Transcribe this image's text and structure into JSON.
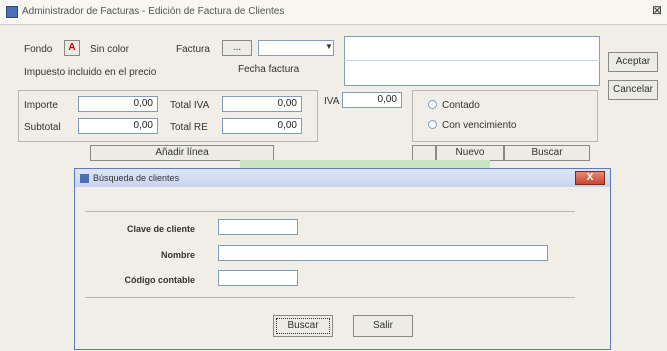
{
  "window": {
    "title": "Administrador de Facturas - Edición de Factura de Clientes",
    "close_glyph": "⊠"
  },
  "top": {
    "color_label": "Fondo",
    "color_button": "A",
    "color_value": "Sin color",
    "field2_label": "Factura",
    "ellipsis": "...",
    "combo_arrow": "▼",
    "discount_label": "Impuesto incluido en el precio",
    "date_label": "Fecha factura"
  },
  "totals": [
    {
      "label": "Importe",
      "value": "0,00"
    },
    {
      "label": "Subtotal",
      "value": "0,00"
    },
    {
      "label": "Total IVA",
      "value": "0,00"
    },
    {
      "label": "Total RE",
      "value": "0,00"
    }
  ],
  "iva": {
    "label": "IVA",
    "value": "0,00"
  },
  "options": {
    "radio1": "Contado",
    "radio2": "Con vencimiento"
  },
  "buttons": {
    "accept": "Aceptar",
    "cancel": "Cancelar",
    "add_line": "Añadir línea",
    "sub1": "Nuevo",
    "sub2": "Buscar"
  },
  "dialog": {
    "title": "Búsqueda de clientes",
    "close": "X",
    "fields": [
      {
        "label": "Clave de cliente"
      },
      {
        "label": "Nombre"
      },
      {
        "label": "Código contable"
      }
    ],
    "buscar": "Buscar",
    "salir": "Salir"
  },
  "colors": {
    "accent": "#c8472e",
    "titlebar": "#c7d4ee",
    "grid_highlight": "#c9e4c2"
  }
}
